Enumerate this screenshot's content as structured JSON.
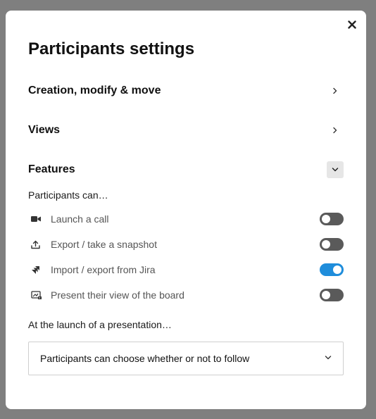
{
  "modal": {
    "title": "Participants settings",
    "close_icon": "close-icon"
  },
  "sections": [
    {
      "label": "Creation, modify & move",
      "icon": "chevron-right-icon"
    },
    {
      "label": "Views",
      "icon": "chevron-right-icon"
    },
    {
      "label": "Features",
      "icon": "chevron-down-icon"
    }
  ],
  "features": {
    "intro": "Participants can…",
    "items": [
      {
        "label": "Launch a call",
        "icon": "video-camera-icon",
        "enabled": false
      },
      {
        "label": "Export / take a snapshot",
        "icon": "upload-icon",
        "enabled": false
      },
      {
        "label": "Import / export from Jira",
        "icon": "jira-icon",
        "enabled": true
      },
      {
        "label": "Present their view of the board",
        "icon": "present-view-icon",
        "enabled": false
      }
    ]
  },
  "presentation": {
    "label": "At the launch of a presentation…",
    "selected": "Participants can choose whether or not to follow",
    "icon": "chevron-down-icon"
  },
  "colors": {
    "toggle_on": "#1f8ddb",
    "toggle_off": "#5a5a5a",
    "overlay": "#7f7f7f"
  }
}
